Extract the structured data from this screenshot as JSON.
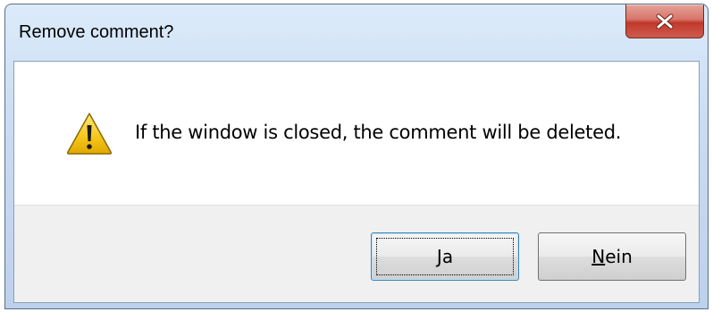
{
  "window": {
    "title": "Remove comment?",
    "close_icon": "close-icon"
  },
  "message": {
    "icon": "warning-icon",
    "text": "If the window is closed, the comment will be deleted."
  },
  "buttons": {
    "yes": {
      "mnemonic": "J",
      "rest": "a",
      "label": "Ja"
    },
    "no": {
      "mnemonic": "N",
      "rest": "ein",
      "label": "Nein"
    }
  },
  "colors": {
    "close_button": "#c0392b",
    "warning_fill": "#f5c61a",
    "default_button_border": "#3c7fb1"
  }
}
